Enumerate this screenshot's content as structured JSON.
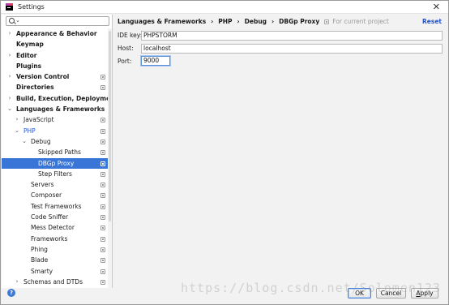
{
  "window": {
    "title": "Settings",
    "close_glyph": "✕"
  },
  "search": {
    "value": "",
    "placeholder": ""
  },
  "tree": [
    {
      "label": "Appearance & Behavior",
      "indent": 0,
      "arrow": "›",
      "bold": true,
      "proj": false
    },
    {
      "label": "Keymap",
      "indent": 0,
      "arrow": "",
      "bold": true,
      "proj": false
    },
    {
      "label": "Editor",
      "indent": 0,
      "arrow": "›",
      "bold": true,
      "proj": false
    },
    {
      "label": "Plugins",
      "indent": 0,
      "arrow": "",
      "bold": true,
      "proj": false
    },
    {
      "label": "Version Control",
      "indent": 0,
      "arrow": "›",
      "bold": true,
      "proj": true
    },
    {
      "label": "Directories",
      "indent": 0,
      "arrow": "",
      "bold": true,
      "proj": true
    },
    {
      "label": "Build, Execution, Deployment",
      "indent": 0,
      "arrow": "›",
      "bold": true,
      "proj": false
    },
    {
      "label": "Languages & Frameworks",
      "indent": 0,
      "arrow": "⌄",
      "bold": true,
      "proj": false
    },
    {
      "label": "JavaScript",
      "indent": 1,
      "arrow": "›",
      "bold": false,
      "proj": true
    },
    {
      "label": "PHP",
      "indent": 1,
      "arrow": "⌄",
      "bold": false,
      "proj": true,
      "blue": true
    },
    {
      "label": "Debug",
      "indent": 2,
      "arrow": "⌄",
      "bold": false,
      "proj": true
    },
    {
      "label": "Skipped Paths",
      "indent": 3,
      "arrow": "",
      "bold": false,
      "proj": true
    },
    {
      "label": "DBGp Proxy",
      "indent": 3,
      "arrow": "",
      "bold": false,
      "proj": true,
      "selected": true
    },
    {
      "label": "Step Filters",
      "indent": 3,
      "arrow": "",
      "bold": false,
      "proj": true
    },
    {
      "label": "Servers",
      "indent": 2,
      "arrow": "",
      "bold": false,
      "proj": true
    },
    {
      "label": "Composer",
      "indent": 2,
      "arrow": "",
      "bold": false,
      "proj": true
    },
    {
      "label": "Test Frameworks",
      "indent": 2,
      "arrow": "",
      "bold": false,
      "proj": true
    },
    {
      "label": "Code Sniffer",
      "indent": 2,
      "arrow": "",
      "bold": false,
      "proj": true
    },
    {
      "label": "Mess Detector",
      "indent": 2,
      "arrow": "",
      "bold": false,
      "proj": true
    },
    {
      "label": "Frameworks",
      "indent": 2,
      "arrow": "",
      "bold": false,
      "proj": true
    },
    {
      "label": "Phing",
      "indent": 2,
      "arrow": "",
      "bold": false,
      "proj": true
    },
    {
      "label": "Blade",
      "indent": 2,
      "arrow": "",
      "bold": false,
      "proj": true
    },
    {
      "label": "Smarty",
      "indent": 2,
      "arrow": "",
      "bold": false,
      "proj": true
    },
    {
      "label": "Schemas and DTDs",
      "indent": 1,
      "arrow": "›",
      "bold": false,
      "proj": true
    }
  ],
  "breadcrumb": {
    "items": [
      "Languages & Frameworks",
      "PHP",
      "Debug",
      "DBGp Proxy"
    ],
    "separator": "›",
    "scope_label": "For current project"
  },
  "reset_label": "Reset",
  "form": {
    "ide_key": {
      "label": "IDE key:",
      "value": "PHPSTORM"
    },
    "host": {
      "label": "Host:",
      "value": "localhost"
    },
    "port": {
      "label": "Port:",
      "value": "9000"
    }
  },
  "buttons": {
    "ok": "OK",
    "cancel": "Cancel",
    "apply_prefix": "",
    "apply_underlined": "A",
    "apply_rest": "pply"
  },
  "help_label": "?",
  "watermark": "https://blog.csdn.net/Solomen123",
  "colors": {
    "accent": "#3875d7",
    "link": "#2554c7",
    "selection_text": "#ffffff"
  }
}
